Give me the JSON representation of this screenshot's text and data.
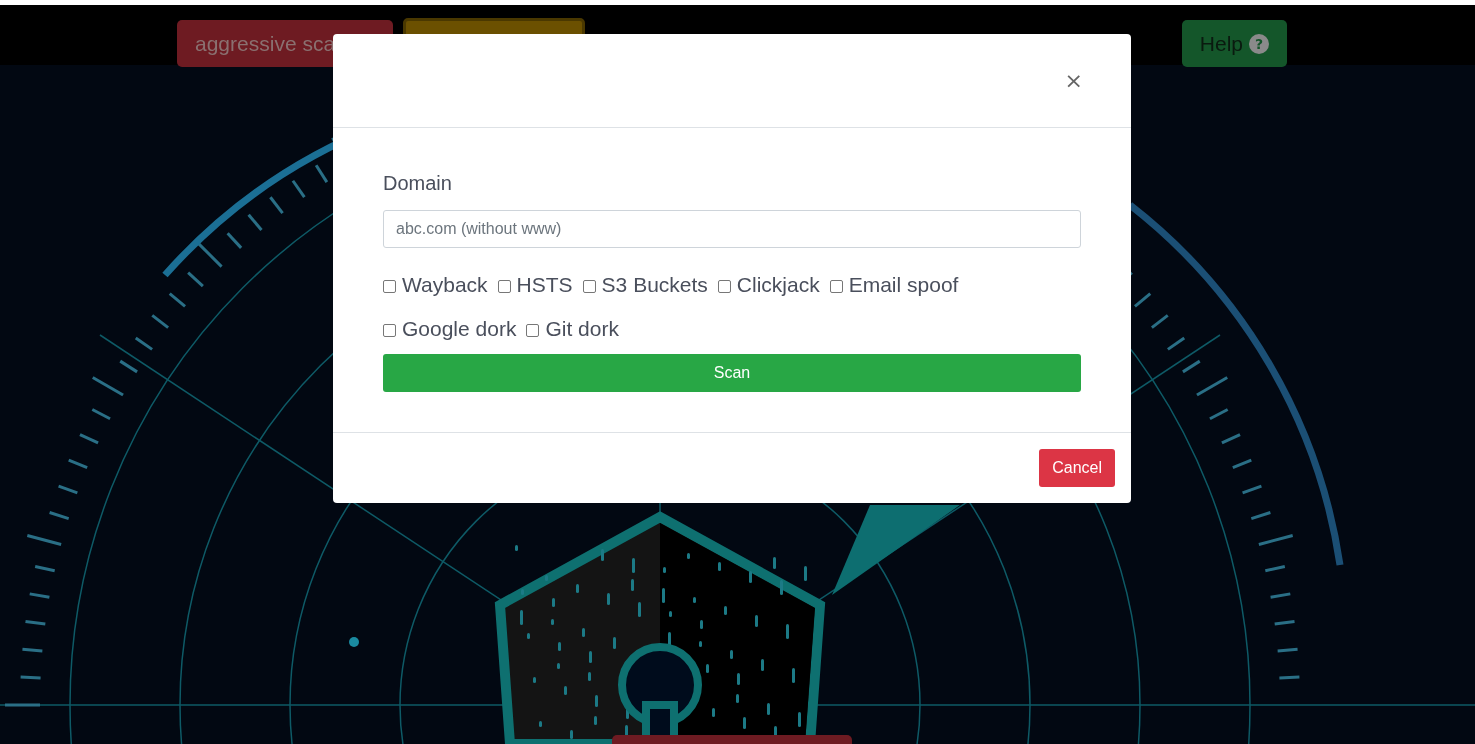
{
  "top_buttons": [
    {
      "kind": "danger",
      "label": "aggressive sca"
    },
    {
      "kind": "warning"
    },
    {
      "kind": "help",
      "label": "Help",
      "icon": "?"
    }
  ],
  "bottom_button": {
    "kind": "danger"
  },
  "modal": {
    "close": "×",
    "domain_label": "Domain",
    "domain_field": {
      "placeholder": "abc.com (without www)"
    },
    "options": [
      {
        "label": "Wayback",
        "checked": false
      },
      {
        "label": "HSTS",
        "checked": false
      },
      {
        "label": "S3 Buckets",
        "checked": false
      },
      {
        "label": "Clickjack",
        "checked": false
      },
      {
        "label": "Email spoof",
        "checked": false
      },
      {
        "label": "Google dork",
        "checked": false
      },
      {
        "label": "Git dork",
        "checked": false
      }
    ],
    "scan_button": "Scan",
    "cancel_button": "Cancel"
  }
}
